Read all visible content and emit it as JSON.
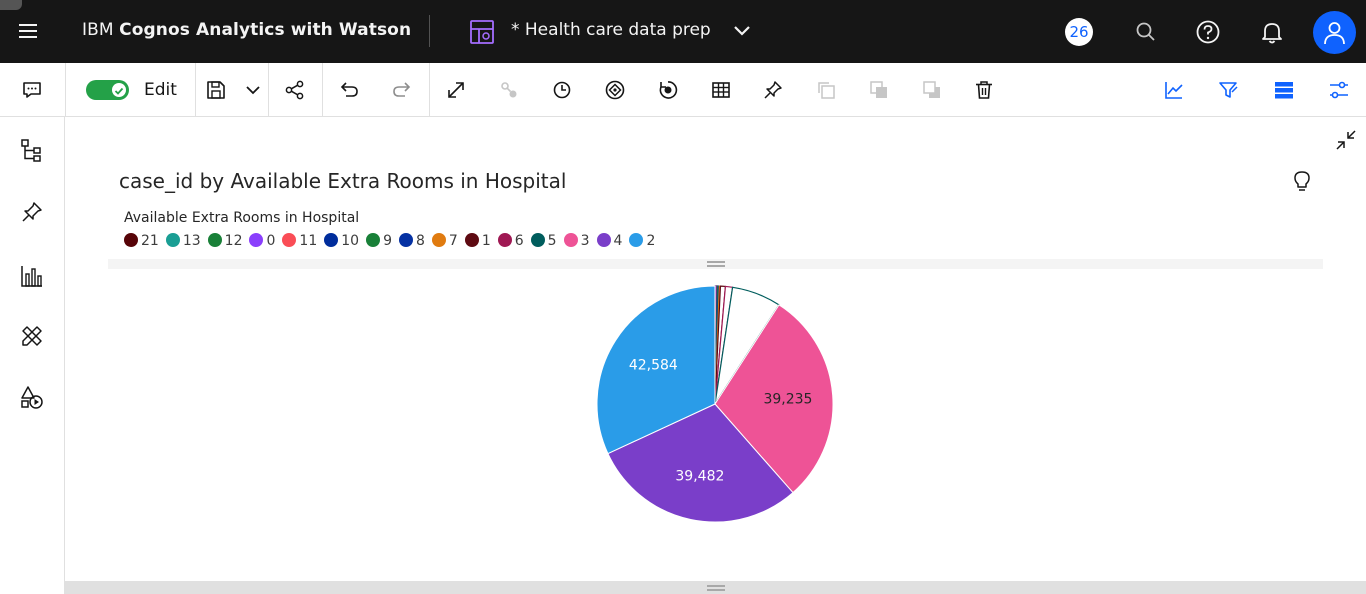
{
  "app": {
    "brand_prefix": "IBM",
    "brand_name": "Cognos Analytics with Watson",
    "dashboard_title": "* Health care data prep",
    "notification_count": "26"
  },
  "toolbar": {
    "edit_label": "Edit",
    "edit_on": true
  },
  "colors": {
    "topbar": "#161616",
    "accent": "#0f62fe",
    "toggle_on": "#24a148"
  },
  "visualization": {
    "title": "case_id by Available Extra Rooms in Hospital",
    "legend_title": "Available Extra Rooms in Hospital",
    "legend": [
      {
        "label": "21",
        "color": "#570408"
      },
      {
        "label": "13",
        "color": "#1a9e94"
      },
      {
        "label": "12",
        "color": "#198038"
      },
      {
        "label": "0",
        "color": "#8a3ffc"
      },
      {
        "label": "11",
        "color": "#fa4d56"
      },
      {
        "label": "10",
        "color": "#002d9c"
      },
      {
        "label": "9",
        "color": "#198038"
      },
      {
        "label": "8",
        "color": "#0531a3"
      },
      {
        "label": "7",
        "color": "#e07b10"
      },
      {
        "label": "1",
        "color": "#5e0a12"
      },
      {
        "label": "6",
        "color": "#9f1853"
      },
      {
        "label": "5",
        "color": "#005d5d"
      },
      {
        "label": "3",
        "color": "#ee5396"
      },
      {
        "label": "4",
        "color": "#7a3ec9"
      },
      {
        "label": "2",
        "color": "#2a9ce8"
      }
    ]
  },
  "chart_data": {
    "type": "pie",
    "title": "case_id by Available Extra Rooms in Hospital",
    "legend_title": "Available Extra Rooms in Hospital",
    "legend_position": "top-left",
    "slices": [
      {
        "label": "21",
        "value": 40,
        "color": "#570408",
        "show_label": false
      },
      {
        "label": "13",
        "value": 60,
        "color": "#1a9e94",
        "show_label": false
      },
      {
        "label": "12",
        "value": 80,
        "color": "#198038",
        "show_label": false
      },
      {
        "label": "0",
        "value": 90,
        "color": "#8a3ffc",
        "show_label": false
      },
      {
        "label": "11",
        "value": 100,
        "color": "#fa4d56",
        "show_label": false
      },
      {
        "label": "10",
        "value": 120,
        "color": "#002d9c",
        "show_label": false
      },
      {
        "label": "9",
        "value": 140,
        "color": "#198038",
        "show_label": false
      },
      {
        "label": "8",
        "value": 150,
        "color": "#0531a3",
        "show_label": false
      },
      {
        "label": "7",
        "value": 200,
        "color": "#e07b10",
        "show_label": false
      },
      {
        "label": "1",
        "value": 900,
        "color": "#5e0a12",
        "show_label": false
      },
      {
        "label": "6",
        "value": 1300,
        "color": "#9f1853",
        "show_label": false
      },
      {
        "label": "5",
        "value": 9000,
        "color": "#005d5d",
        "show_label": false
      },
      {
        "label": "3",
        "value": 39235,
        "color": "#ee5396",
        "show_label": true,
        "display": "39,235",
        "label_color": "#262626"
      },
      {
        "label": "4",
        "value": 39482,
        "color": "#7a3ec9",
        "show_label": true,
        "display": "39,482",
        "label_color": "#ffffff"
      },
      {
        "label": "2",
        "value": 42584,
        "color": "#2a9ce8",
        "show_label": true,
        "display": "42,584",
        "label_color": "#ffffff"
      }
    ]
  }
}
